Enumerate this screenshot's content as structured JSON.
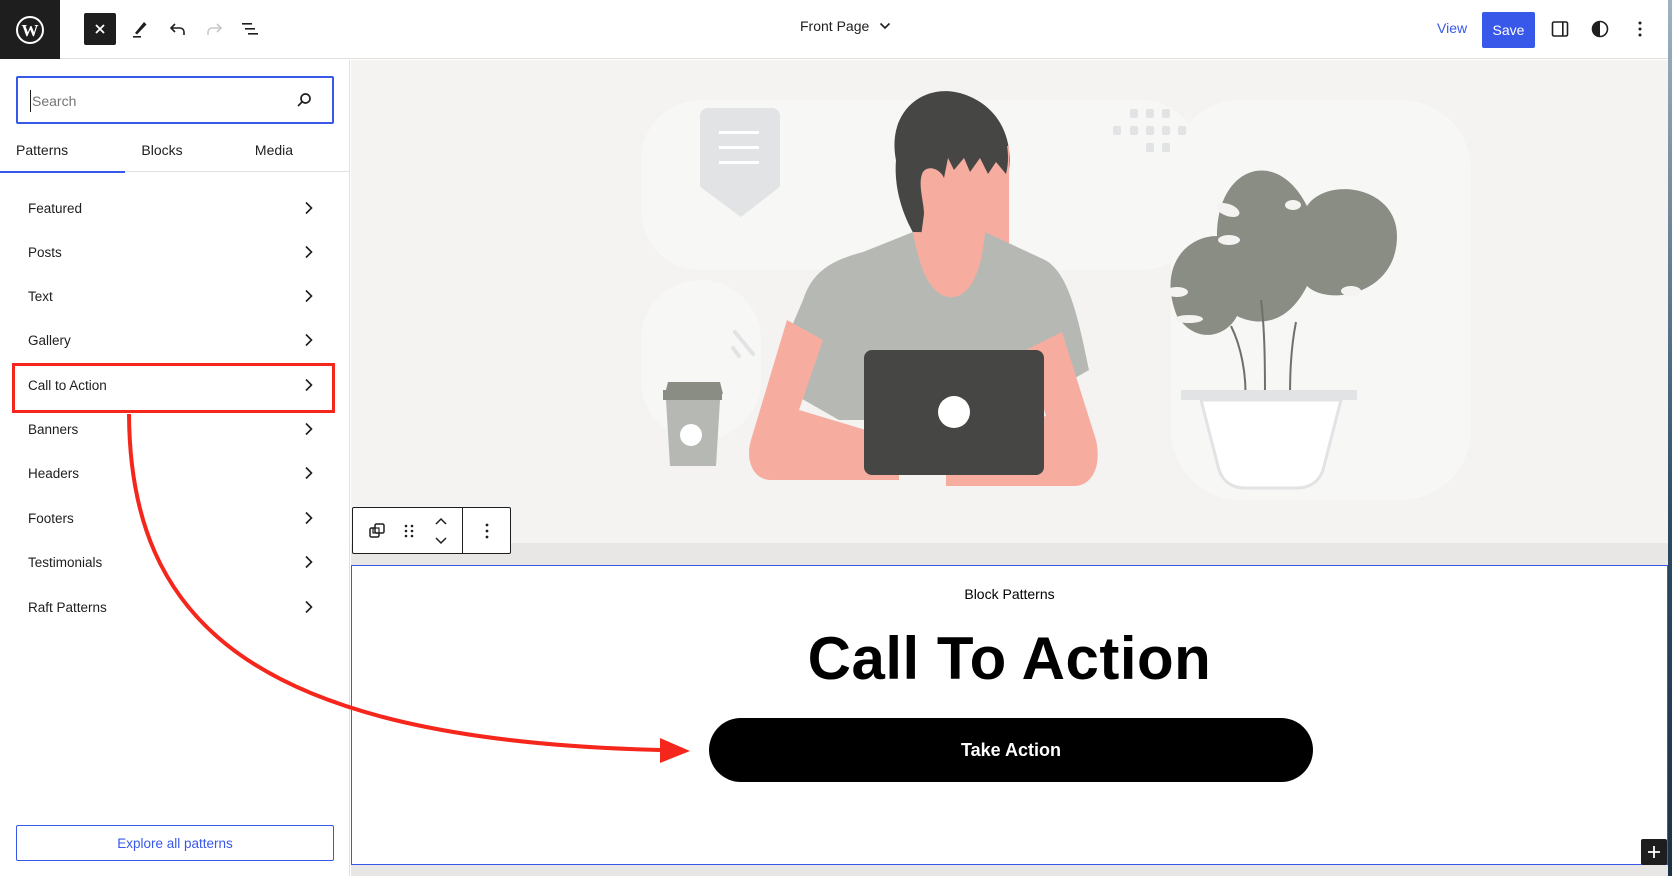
{
  "topbar": {
    "logo": "wordpress-logo",
    "close_label": "Close",
    "document_title": "Front Page",
    "view_label": "View",
    "save_label": "Save"
  },
  "sidebar": {
    "search": {
      "placeholder": "Search",
      "value": ""
    },
    "tabs": [
      {
        "label": "Patterns",
        "active": true
      },
      {
        "label": "Blocks",
        "active": false
      },
      {
        "label": "Media",
        "active": false
      }
    ],
    "categories": [
      {
        "label": "Featured"
      },
      {
        "label": "Posts"
      },
      {
        "label": "Text"
      },
      {
        "label": "Gallery"
      },
      {
        "label": "Call to Action",
        "highlighted": true
      },
      {
        "label": "Banners"
      },
      {
        "label": "Headers"
      },
      {
        "label": "Footers"
      },
      {
        "label": "Testimonials"
      },
      {
        "label": "Raft Patterns"
      }
    ],
    "explore_label": "Explore all patterns"
  },
  "canvas": {
    "hero_illustration": "person-with-laptop-coffee-plant",
    "cta_block": {
      "kicker": "Block Patterns",
      "heading": "Call To Action",
      "button_label": "Take Action"
    }
  },
  "annotation": {
    "type": "red-arrow",
    "from": "Call to Action",
    "to": "Take Action",
    "color": "#f5261b"
  },
  "colors": {
    "accent": "#3858e9",
    "dark": "#1e1e1e",
    "annotation_red": "#f5261b"
  }
}
